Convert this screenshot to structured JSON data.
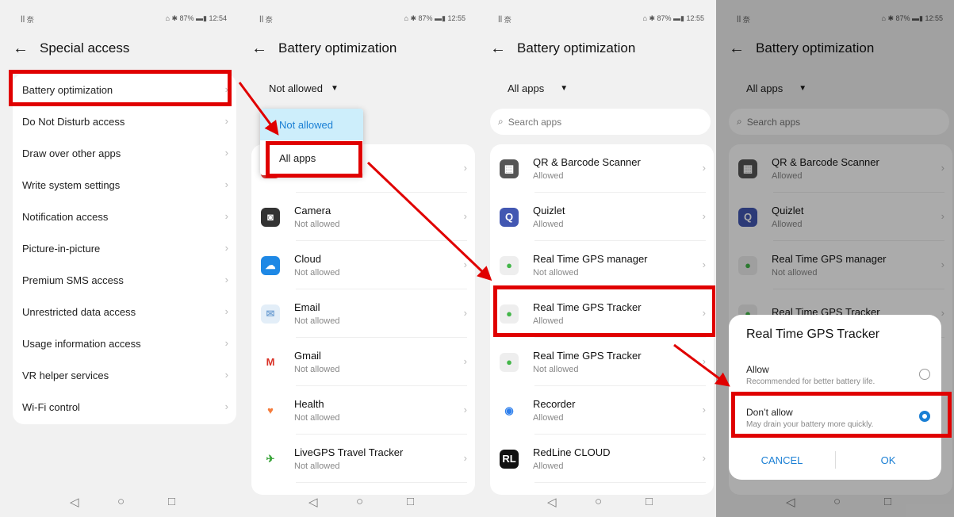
{
  "status_bar": {
    "signal": "ꟾꟾ 奈",
    "p1_right": "⌂ ✱ 87% ▬▮ 12:54",
    "right": "⌂ ✱ 87% ▬▮ 12:55"
  },
  "panel1": {
    "title": "Special access",
    "items": [
      {
        "label": "Battery optimization"
      },
      {
        "label": "Do Not Disturb access"
      },
      {
        "label": "Draw over other apps"
      },
      {
        "label": "Write system settings"
      },
      {
        "label": "Notification access"
      },
      {
        "label": "Picture-in-picture"
      },
      {
        "label": "Premium SMS access"
      },
      {
        "label": "Unrestricted data access"
      },
      {
        "label": "Usage information access"
      },
      {
        "label": "VR helper services"
      },
      {
        "label": "Wi-Fi control"
      }
    ]
  },
  "panel2": {
    "title": "Battery optimization",
    "filter": "Not allowed",
    "dropdown_options": [
      "Not allowed",
      "All apps"
    ],
    "apps": [
      {
        "name": "",
        "status": "Not allowed",
        "icon": "red-app-icon",
        "color": "#e53935"
      },
      {
        "name": "Camera",
        "status": "Not allowed",
        "icon": "camera-icon",
        "color": "#333333"
      },
      {
        "name": "Cloud",
        "status": "Not allowed",
        "icon": "cloud-icon",
        "color": "#1e88e5"
      },
      {
        "name": "Email",
        "status": "Not allowed",
        "icon": "email-icon",
        "color": "#e3eef8"
      },
      {
        "name": "Gmail",
        "status": "Not allowed",
        "icon": "gmail-icon",
        "color": "#ffffff"
      },
      {
        "name": "Health",
        "status": "Not allowed",
        "icon": "health-icon",
        "color": "#ffffff"
      },
      {
        "name": "LiveGPS Travel Tracker",
        "status": "Not allowed",
        "icon": "livegps-icon",
        "color": "#ffffff"
      }
    ]
  },
  "panel3": {
    "title": "Battery optimization",
    "filter": "All apps",
    "search_placeholder": "Search apps",
    "apps": [
      {
        "name": "QR & Barcode Scanner",
        "status": "Allowed",
        "icon": "qr-icon",
        "color": "#555555"
      },
      {
        "name": "Quizlet",
        "status": "Allowed",
        "icon": "quizlet-icon",
        "color": "#4257b2"
      },
      {
        "name": "Real Time GPS manager",
        "status": "Not allowed",
        "icon": "gps-icon",
        "color": "#eeeeee"
      },
      {
        "name": "Real Time GPS Tracker",
        "status": "Allowed",
        "icon": "gps-icon",
        "color": "#eeeeee"
      },
      {
        "name": "Real Time GPS Tracker",
        "status": "Not allowed",
        "icon": "gps-icon",
        "color": "#eeeeee"
      },
      {
        "name": "Recorder",
        "status": "Allowed",
        "icon": "recorder-icon",
        "color": "#ffffff"
      },
      {
        "name": "RedLine CLOUD",
        "status": "Allowed",
        "icon": "redline-icon",
        "color": "#111111"
      }
    ]
  },
  "panel4": {
    "title": "Battery optimization",
    "filter": "All apps",
    "search_placeholder": "Search apps",
    "apps": [
      {
        "name": "QR & Barcode Scanner",
        "status": "Allowed"
      },
      {
        "name": "Quizlet",
        "status": "Allowed"
      },
      {
        "name": "Real Time GPS manager",
        "status": "Not allowed"
      },
      {
        "name": "Real Time GPS Tracker",
        "status": ""
      }
    ],
    "dialog": {
      "title": "Real Time GPS Tracker",
      "allow_label": "Allow",
      "allow_desc": "Recommended for better battery life.",
      "deny_label": "Don’t allow",
      "deny_desc": "May drain your battery more quickly.",
      "cancel": "CANCEL",
      "ok": "OK"
    }
  },
  "colors": {
    "highlight_red": "#e00000",
    "accent_blue": "#1a7fd4",
    "dropdown_selected": "#cdeefb"
  }
}
